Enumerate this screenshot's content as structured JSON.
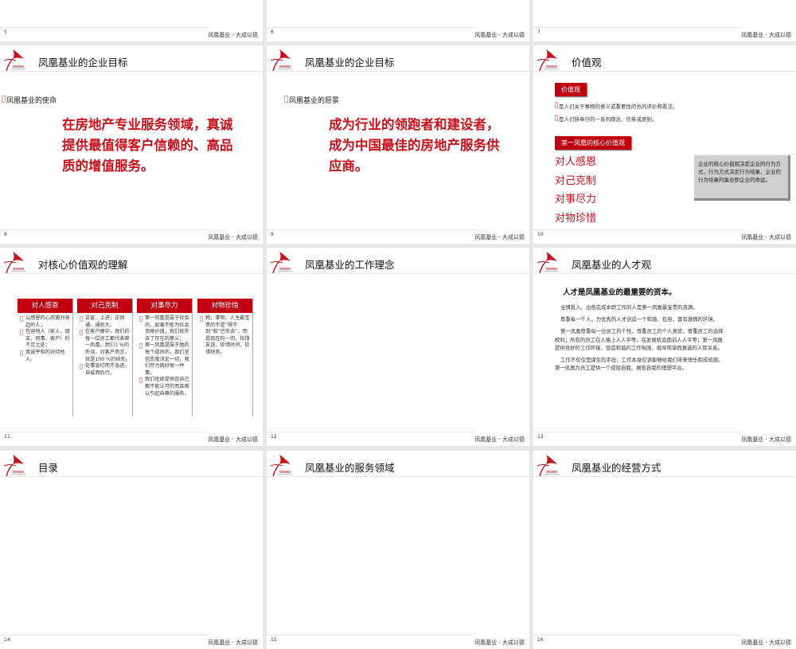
{
  "footer": "凤凰基业 · 大成以德",
  "slides": [
    {
      "number": "5",
      "title": ""
    },
    {
      "number": "6",
      "title": ""
    },
    {
      "number": "7",
      "title": ""
    },
    {
      "number": "8",
      "title": "凤凰基业的企业目标",
      "bullet": "凤凰基业的使命",
      "body": [
        "在房地产专业服务领域，真诚",
        "提供最值得客户信赖的、高品",
        "质的增值服务。"
      ]
    },
    {
      "number": "9",
      "title": "凤凰基业的企业目标",
      "bullet": "凤凰基业的愿景",
      "body": [
        "成为行业的领跑者和建设者，",
        "成为中国最佳的房地产服务供",
        "应商。"
      ]
    },
    {
      "number": "10",
      "title": "价值观",
      "box1": "价值观",
      "bullets": [
        "是人们关于事物的意义或重要性的总的评价和看法。",
        "是人们所奉行的一系列观念、信条或原则。"
      ],
      "box2": "第一凤凰的核心价值观",
      "values": [
        "对人感恩",
        "对己克制",
        "对事尽力",
        "对物珍惜"
      ],
      "note": "企业的核心价值观决定企业的行为方式，行为方式决定行为结果，企业的行为结果的集合即企业的命运。"
    },
    {
      "number": "11",
      "title": "对核心价值观的理解",
      "columns": [
        {
          "head": "对人感恩",
          "items": [
            "以感恩的心态面对身边的人；",
            "包容他人（家人、朋友、同事、客户）的不足之处；",
            "真诚平和的对待他人。"
          ]
        },
        {
          "head": "对己克制",
          "items": [
            "正直、上进；正则通、通则大。",
            "在客户眼中，我们的每一位员工都代表第一凤凰。我们1 %的失误，对客户而言，就是100 %的损失。",
            "处事急切而不急进，自省而后行。"
          ]
        },
        {
          "head": "对事尽力",
          "items": [
            "第一凤凰是属于社会的，如果不能为社会贡献价值，我们就失去了存在的意义；",
            "第一凤凰是属于她的每个成员的，我们坚信态度决定一切，我们尽力做好每一件事。",
            "我们拒绝提供连自己都不能认可的而且难以引起自尊的服务。"
          ]
        },
        {
          "head": "对物珍惜",
          "items": [
            "物，事物。人生最宝贵的不是“得不到”和“已失去”，而是现在的一切，珍惜友谊，珍惜时间，珍惜财务。"
          ]
        }
      ]
    },
    {
      "number": "12",
      "title": "凤凰基业的工作理念"
    },
    {
      "number": "13",
      "title": "凤凰基业的人才观",
      "heading": "人才是凤凰基业的最重要的资本。",
      "paragraphs": [
        "全情投入、出色完成本职工作的人是第一凤凰最宝贵的资源。",
        "尊重每一个人，为优秀的人才创造一个和谐、包容、富有激情的环境。",
        "第一凤凰尊重每一位员工的个性，尊重员工的个人意愿，尊重员工的选择权利；所有的员工在人格上人人平等，在发展机会面前人人平等；第一凤凰提供良好的工作环境，营造和谐的工作氛围，倡导简单而真诚的人际关系。",
        "工作不仅仅是谋生的手段，工作本身应该能够给我们带来快乐和成就感。第一凤凰为员工提供一个成就自我、展现自我的理想平台。"
      ]
    },
    {
      "number": "14",
      "title": "目录"
    },
    {
      "number": "15",
      "title": "凤凰基业的服务领域"
    },
    {
      "number": "16",
      "title": "凤凰基业的经营方式"
    }
  ]
}
